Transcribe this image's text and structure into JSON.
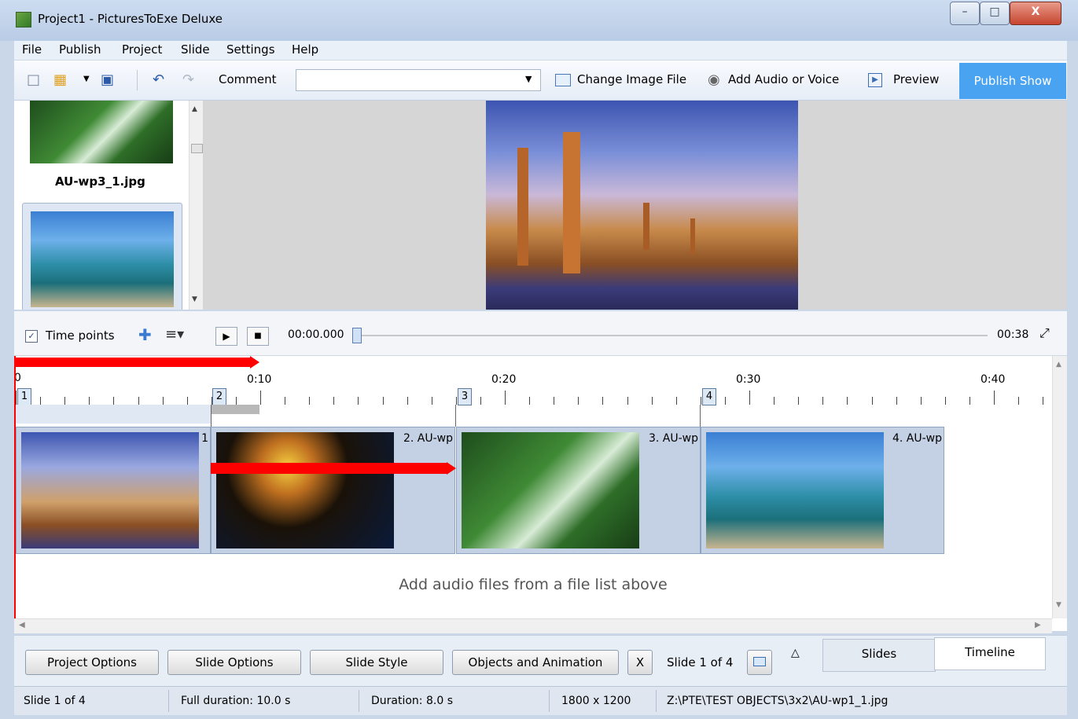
{
  "window": {
    "title": "Project1 - PicturesToExe Deluxe",
    "minimize": "–",
    "maximize": "□",
    "close": "X"
  },
  "menu": {
    "file": "File",
    "publish": "Publish",
    "project": "Project",
    "slide": "Slide",
    "settings": "Settings",
    "help": "Help"
  },
  "toolbar": {
    "comment_label": "Comment",
    "comment_value": "",
    "change_image": "Change Image File",
    "add_audio": "Add Audio or Voice",
    "preview": "Preview",
    "publish_show": "Publish Show"
  },
  "thumbs": {
    "item1_label": "AU-wp3_1.jpg"
  },
  "playback": {
    "time_points_label": "Time points",
    "time_points_checked": true,
    "current_time": "00:00.000",
    "total_time": "00:38"
  },
  "ruler": {
    "labels": [
      "0",
      "0:10",
      "0:20",
      "0:30",
      "0:40"
    ],
    "segments": [
      "1",
      "2",
      "3",
      "4"
    ]
  },
  "clips": [
    {
      "label": "1"
    },
    {
      "label": "2. AU-wp"
    },
    {
      "label": "3. AU-wp"
    },
    {
      "label": "4. AU-wp"
    }
  ],
  "timeline": {
    "audio_hint": "Add audio files from a file list above"
  },
  "bottom": {
    "project_options": "Project Options",
    "slide_options": "Slide Options",
    "slide_style": "Slide Style",
    "objects_animation": "Objects and Animation",
    "x_button": "X",
    "slide_counter": "Slide 1 of 4",
    "tab_slides": "Slides",
    "tab_timeline": "Timeline"
  },
  "status": {
    "slide": "Slide 1 of 4",
    "full_duration": "Full duration: 10.0 s",
    "duration": "Duration: 8.0 s",
    "resolution": "1800 x 1200",
    "path": "Z:\\PTE\\TEST OBJECTS\\3x2\\AU-wp1_1.jpg"
  },
  "colors": {
    "accent": "#4aa3f0",
    "arrow": "#ff0000",
    "clip_bg": "#c4d1e5"
  }
}
